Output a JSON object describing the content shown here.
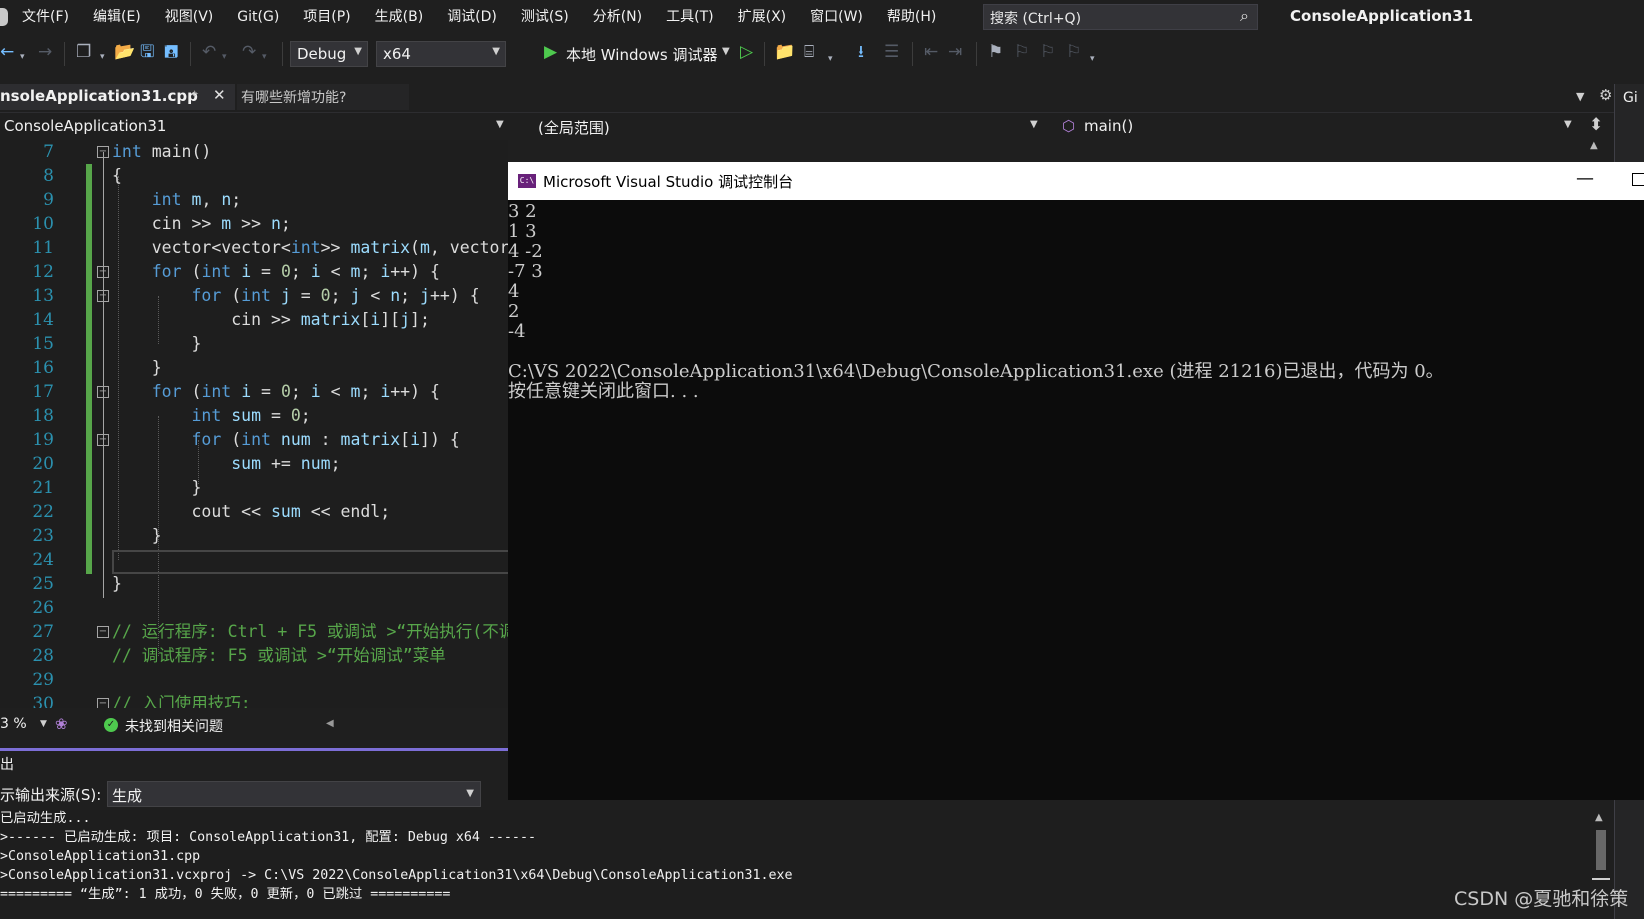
{
  "menu": {
    "items": [
      "文件(F)",
      "编辑(E)",
      "视图(V)",
      "Git(G)",
      "项目(P)",
      "生成(B)",
      "调试(D)",
      "测试(S)",
      "分析(N)",
      "工具(T)",
      "扩展(X)",
      "窗口(W)",
      "帮助(H)"
    ],
    "search_placeholder": "搜索 (Ctrl+Q)",
    "window_title": "ConsoleApplication31"
  },
  "toolbar": {
    "configuration": "Debug",
    "platform": "x64",
    "run_label": "本地 Windows 调试器"
  },
  "tabs": {
    "active": "nsoleApplication31.cpp",
    "second": "有哪些新增功能?"
  },
  "navbar": {
    "project": "ConsoleApplication31",
    "scope": "(全局范围)",
    "member": "main()"
  },
  "editor": {
    "line_numbers": [
      "7",
      "8",
      "9",
      "10",
      "11",
      "12",
      "13",
      "14",
      "15",
      "16",
      "17",
      "18",
      "19",
      "20",
      "21",
      "22",
      "23",
      "24",
      "25",
      "26",
      "27",
      "28",
      "29",
      "30"
    ],
    "zoom": "3 %",
    "issues": "未找到相关问题"
  },
  "output": {
    "title": "出",
    "source_label": "示输出来源(S):",
    "source_value": "生成",
    "lines": [
      "已启动生成...",
      ">------ 已启动生成: 项目: ConsoleApplication31, 配置: Debug x64 ------",
      ">ConsoleApplication31.cpp",
      ">ConsoleApplication31.vcxproj -> C:\\VS 2022\\ConsoleApplication31\\x64\\Debug\\ConsoleApplication31.exe",
      "========= “生成”: 1 成功，0 失败，0 更新，0 已跳过 =========="
    ]
  },
  "console": {
    "title": "Microsoft Visual Studio 调试控制台",
    "icon_text": "C:\\",
    "lines": [
      "3 2",
      "1 3",
      "4 -2",
      "-7 3",
      "4",
      "2",
      "-4",
      "",
      "C:\\VS 2022\\ConsoleApplication31\\x64\\Debug\\ConsoleApplication31.exe (进程 21216)已退出，代码为 0。",
      "按任意键关闭此窗口. . ."
    ]
  },
  "right_edge": "Gi",
  "watermark": "CSDN @夏驰和徐策"
}
